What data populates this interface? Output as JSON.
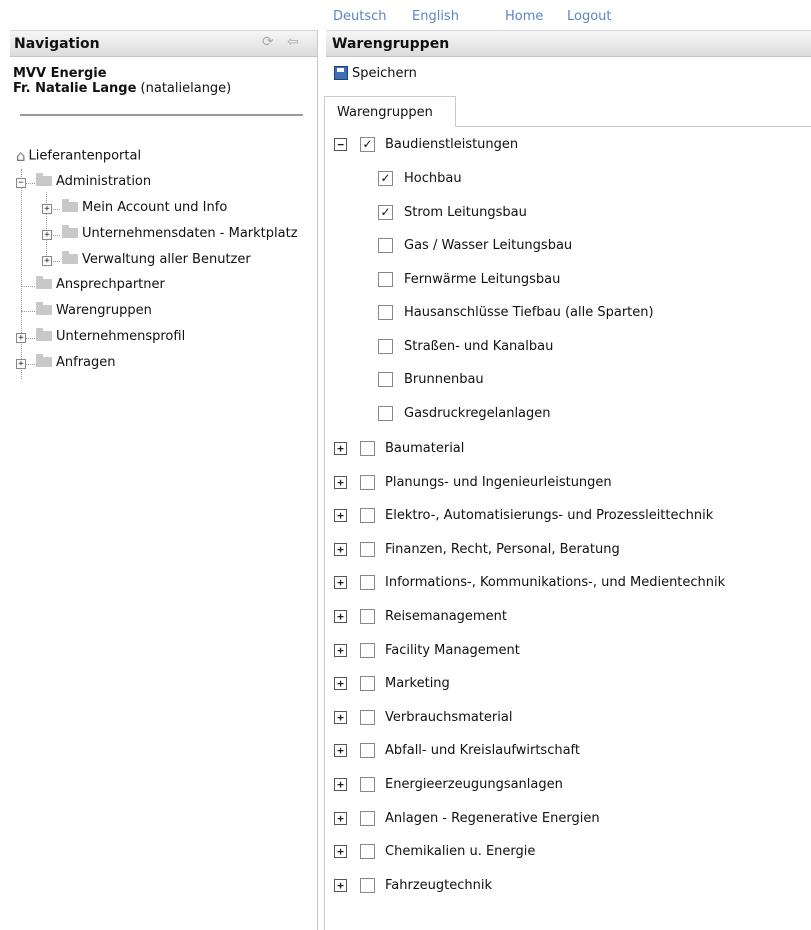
{
  "top_links": [
    "Deutsch",
    "English",
    "Home",
    "Logout"
  ],
  "navigation": {
    "title": "Navigation",
    "org": "MVV Energie",
    "user_name": "Fr. Natalie Lange",
    "user_login": "(natalielange)",
    "tree": {
      "root": "Lieferantenportal",
      "administration": "Administration",
      "admin_children": [
        "Mein Account und Info",
        "Unternehmensdaten - Marktplatz",
        "Verwaltung aller Benutzer"
      ],
      "ansprechpartner": "Ansprechpartner",
      "warengruppen": "Warengruppen",
      "unternehmensprofil": "Unternehmensprofil",
      "anfragen": "Anfragen"
    }
  },
  "main": {
    "title": "Warengruppen",
    "save_label": "Speichern",
    "tab_label": "Warengruppen",
    "expanded_group": {
      "label": "Baudienstleistungen",
      "checked": true,
      "children": [
        {
          "label": "Hochbau",
          "checked": true
        },
        {
          "label": "Strom Leitungsbau",
          "checked": true
        },
        {
          "label": "Gas / Wasser Leitungsbau",
          "checked": false
        },
        {
          "label": "Fernwärme Leitungsbau",
          "checked": false
        },
        {
          "label": "Hausanschlüsse Tiefbau (alle Sparten)",
          "checked": false
        },
        {
          "label": "Straßen- und Kanalbau",
          "checked": false
        },
        {
          "label": "Brunnenbau",
          "checked": false
        },
        {
          "label": "Gasdruckregelanlagen",
          "checked": false
        }
      ]
    },
    "collapsed_groups": [
      "Baumaterial",
      "Planungs- und Ingenieurleistungen",
      "Elektro-, Automatisierungs- und Prozessleittechnik",
      "Finanzen, Recht, Personal, Beratung",
      "Informations-, Kommunikations-, und Medientechnik",
      "Reisemanagement",
      "Facility Management",
      "Marketing",
      "Verbrauchsmaterial",
      "Abfall- und Kreislaufwirtschaft",
      "Energieerzeugungsanlagen",
      "Anlagen - Regenerative Energien",
      "Chemikalien u. Energie",
      "Fahrzeugtechnik"
    ]
  }
}
